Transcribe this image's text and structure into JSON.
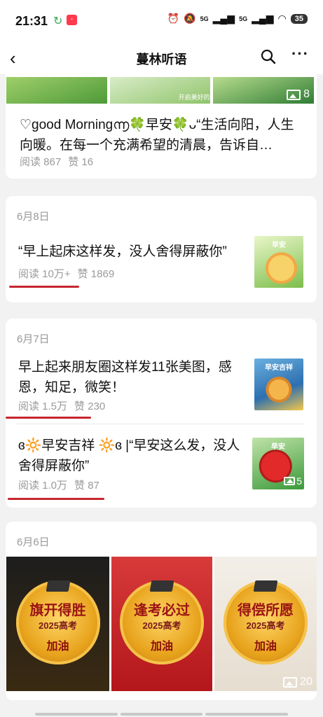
{
  "status_bar": {
    "time": "21:31",
    "network_1": "5G",
    "network_2": "5G",
    "battery": "35"
  },
  "header": {
    "title": "蔓林听语"
  },
  "top_post": {
    "thumb_caption": "开启美好的一",
    "image_count": "8",
    "text": "♡good Morning൬🍀早安🍀ᴗ“生活向阳，人生向暖。在每一个充满希望的清晨，告诉自…",
    "reads": "阅读 867",
    "likes": "赞 16"
  },
  "groups": [
    {
      "date": "6月8日",
      "posts": [
        {
          "text": "“早上起床这样发，没人舍得屏蔽你”",
          "reads": "阅读 10万+",
          "likes": "赞 1869",
          "thumb_label": "早安"
        }
      ]
    },
    {
      "date": "6月7日",
      "posts": [
        {
          "text": "早上起来朋友圈这样发11张美图，感恩，知足，微笑！",
          "reads": "阅读 1.5万",
          "likes": "赞 230",
          "thumb_label": "早安吉祥"
        },
        {
          "text": "ɞ🔆早安吉祥 🔆ɞ |“早安这么发，没人舍得屏蔽你”",
          "reads": "阅读 1.0万",
          "likes": "赞 87",
          "thumb_label": "早安",
          "image_count": "5"
        }
      ]
    },
    {
      "date": "6月6日",
      "badges": [
        {
          "title": "旗开得胜",
          "year": "2025高考",
          "slogan": "加油"
        },
        {
          "title": "逢考必过",
          "year": "2025高考",
          "slogan": "加油"
        },
        {
          "title": "得偿所愿",
          "year": "2025高考",
          "slogan": "加油"
        }
      ],
      "image_count": "20"
    }
  ],
  "colors": {
    "highlight_underline": "#c7262f",
    "background": "#f2f2f2",
    "meta_text": "#9a9a9a"
  }
}
